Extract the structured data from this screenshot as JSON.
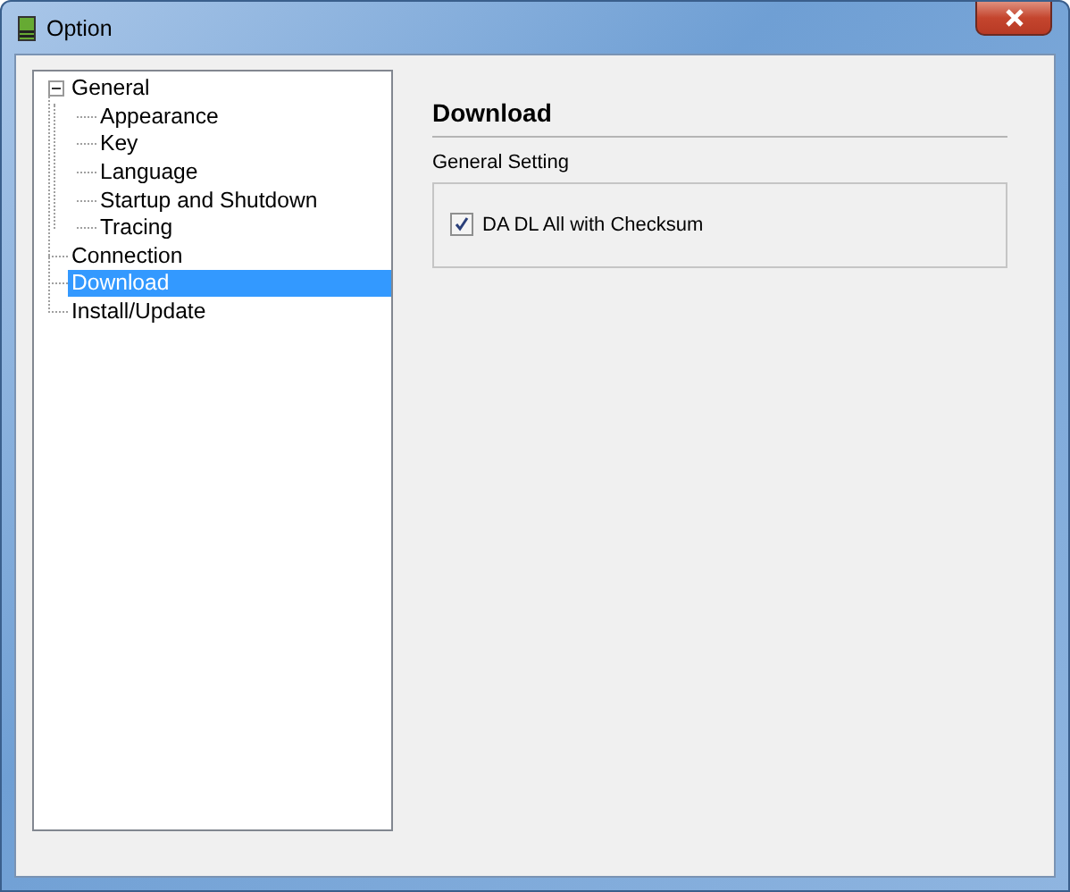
{
  "window": {
    "title": "Option"
  },
  "tree": [
    {
      "label": "General",
      "expanded": true,
      "selected": false,
      "children": [
        {
          "label": "Appearance",
          "selected": false
        },
        {
          "label": "Key",
          "selected": false
        },
        {
          "label": "Language",
          "selected": false
        },
        {
          "label": "Startup and Shutdown",
          "selected": false
        },
        {
          "label": "Tracing",
          "selected": false
        }
      ]
    },
    {
      "label": "Connection",
      "selected": false
    },
    {
      "label": "Download",
      "selected": true
    },
    {
      "label": "Install/Update",
      "selected": false
    }
  ],
  "page": {
    "heading": "Download",
    "group_label": "General Setting",
    "options": [
      {
        "label": "DA DL All with Checksum",
        "checked": true
      }
    ]
  }
}
